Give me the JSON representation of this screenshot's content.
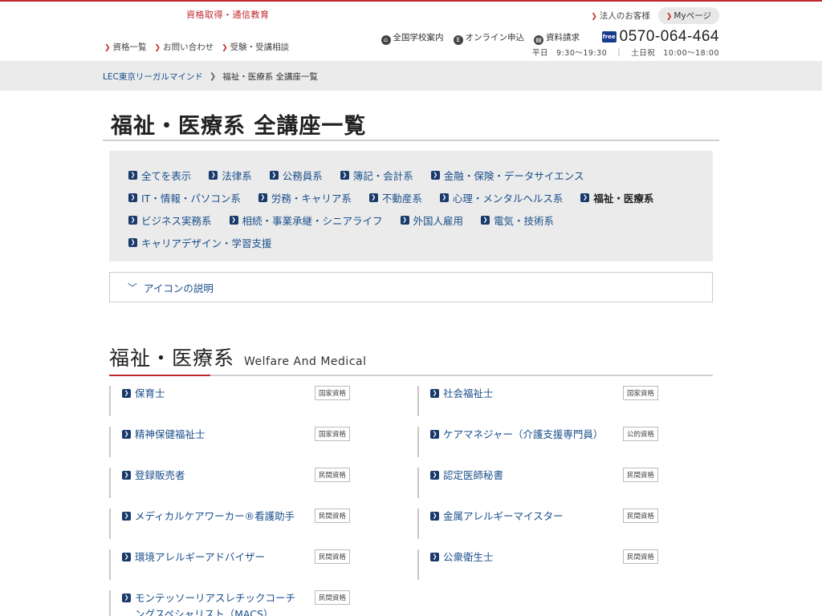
{
  "header": {
    "tagline": "資格取得・通信教育",
    "subnav": [
      "資格一覧",
      "お問い合わせ",
      "受験・受講相談"
    ],
    "corporate_link": "法人のお客様",
    "mypage_label": "Myページ",
    "util_links": [
      {
        "label": "全国学校案内",
        "icon": "school-icon"
      },
      {
        "label": "オンライン申込",
        "icon": "cart-icon"
      },
      {
        "label": "資料請求",
        "icon": "document-icon"
      }
    ],
    "phone_icon_label": "free",
    "phone": "0570-064-464",
    "hours": "平日　9:30～19:30　｜　土日祝　10:00～18:00"
  },
  "breadcrumb": {
    "home": "LEC東京リーガルマインド",
    "current": "福祉・医療系 全講座一覧"
  },
  "page_title": "福祉・医療系 全講座一覧",
  "categories": {
    "row1": [
      "全てを表示",
      "法律系",
      "公務員系",
      "簿記・会計系",
      "金融・保険・データサイエンス"
    ],
    "row2": [
      "IT・情報・パソコン系",
      "労務・キャリア系",
      "不動産系",
      "心理・メンタルヘルス系",
      "福祉・医療系"
    ],
    "row3": [
      "ビジネス実務系",
      "相続・事業承継・シニアライフ",
      "外国人雇用",
      "電気・技術系"
    ],
    "row4": [
      "キャリアデザイン・学習支援"
    ],
    "active": "福祉・医療系"
  },
  "icon_info_label": "アイコンの説明",
  "section": {
    "title_jp": "福祉・医療系",
    "title_en": "Welfare And Medical"
  },
  "courses": [
    {
      "name": "保育士",
      "badge": "国家資格"
    },
    {
      "name": "社会福祉士",
      "badge": "国家資格"
    },
    {
      "name": "精神保健福祉士",
      "badge": "国家資格"
    },
    {
      "name": "ケアマネジャー（介護支援専門員）",
      "badge": "公的資格"
    },
    {
      "name": "登録販売者",
      "badge": "民間資格"
    },
    {
      "name": "認定医師秘書",
      "badge": "民間資格"
    },
    {
      "name": "メディカルケアワーカー®看護助手",
      "badge": "民間資格"
    },
    {
      "name": "金属アレルギーマイスター",
      "badge": "民間資格"
    },
    {
      "name": "環境アレルギーアドバイザー",
      "badge": "民間資格"
    },
    {
      "name": "公衆衛生士",
      "badge": "民間資格"
    },
    {
      "name": "モンテッソーリアスレチックコーチングスペシャリスト（MACS）",
      "badge": "民間資格"
    }
  ],
  "colors": {
    "accent_red": "#c1272d",
    "link_blue": "#1a4f8b",
    "panel_gray": "#ebebeb"
  }
}
